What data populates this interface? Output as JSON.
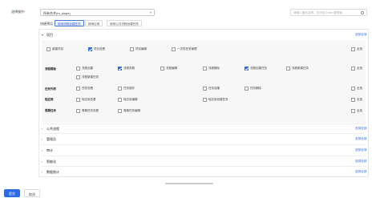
{
  "form": {
    "select_label": "选择操作",
    "required_mark": "*",
    "select_value": "所有合并(m_slope)",
    "search_placeholder": "请输入操作名称，仅可含 Enter 键搜索",
    "preset_label": "快捷预设:",
    "presets": [
      "使用流程创建任务",
      "使用应用",
      "使用公共流程创建任务"
    ]
  },
  "sections": [
    {
      "title": "项目",
      "select_all": "选择全部",
      "expanded": true,
      "groups": [
        {
          "label": "",
          "items": [
            {
              "label": "新建项目",
              "checked": false
            },
            {
              "label": "项目查看",
              "checked": true
            },
            {
              "label": "项目编辑",
              "checked": false
            },
            {
              "label": "一次性任务管理",
              "checked": false
            },
            {
              "label": "全选",
              "checked": false
            }
          ]
        },
        {
          "label": "流程模板",
          "items": [
            {
              "label": "流程创建",
              "checked": false
            },
            {
              "label": "流程查看",
              "checked": true
            },
            {
              "label": "流程编辑",
              "checked": false
            },
            {
              "label": "流程删除",
              "checked": false
            },
            {
              "label": "流程创建任务",
              "checked": true
            },
            {
              "label": "流程新建任务",
              "checked": false
            },
            {
              "label": "全选",
              "checked": false
            },
            {
              "label": "流程新建任务",
              "checked": false
            }
          ]
        },
        {
          "label": "任务列表",
          "items": [
            {
              "label": "任务查看",
              "checked": false
            },
            {
              "label": "任务操作",
              "checked": false
            },
            {
              "label": "任务克隆",
              "checked": false
            },
            {
              "label": "任务删除",
              "checked": false
            },
            {
              "label": "全选",
              "checked": false
            }
          ]
        },
        {
          "label": "轻应用",
          "items": [
            {
              "label": "轻应用查看",
              "checked": false
            },
            {
              "label": "轻应用编辑",
              "checked": false
            },
            {
              "label": "轻应用创建任务",
              "checked": false
            },
            {
              "label": "全选",
              "checked": false
            }
          ]
        },
        {
          "label": "周期任务",
          "items": [
            {
              "label": "周期任务查看",
              "checked": false
            },
            {
              "label": "周期任务编辑",
              "checked": false
            },
            {
              "label": "全选",
              "checked": false
            }
          ]
        }
      ]
    },
    {
      "title": "公共流程",
      "select_all": "选择全部",
      "expanded": false
    },
    {
      "title": "管理员",
      "select_all": "选择全部",
      "expanded": false
    },
    {
      "title": "审计",
      "select_all": "选择全部",
      "expanded": false
    },
    {
      "title": "智能化",
      "select_all": "选择全部",
      "expanded": false
    },
    {
      "title": "数据统计",
      "select_all": "选择全部",
      "expanded": false
    }
  ],
  "footer": {
    "submit": "提交",
    "cancel": "取消"
  },
  "colors": {
    "accent": "#2f6ae6",
    "required": "#e34d59"
  },
  "icons": [
    "chevron-down-icon",
    "search-icon",
    "chevron-right-icon",
    "checkbox-icon"
  ]
}
